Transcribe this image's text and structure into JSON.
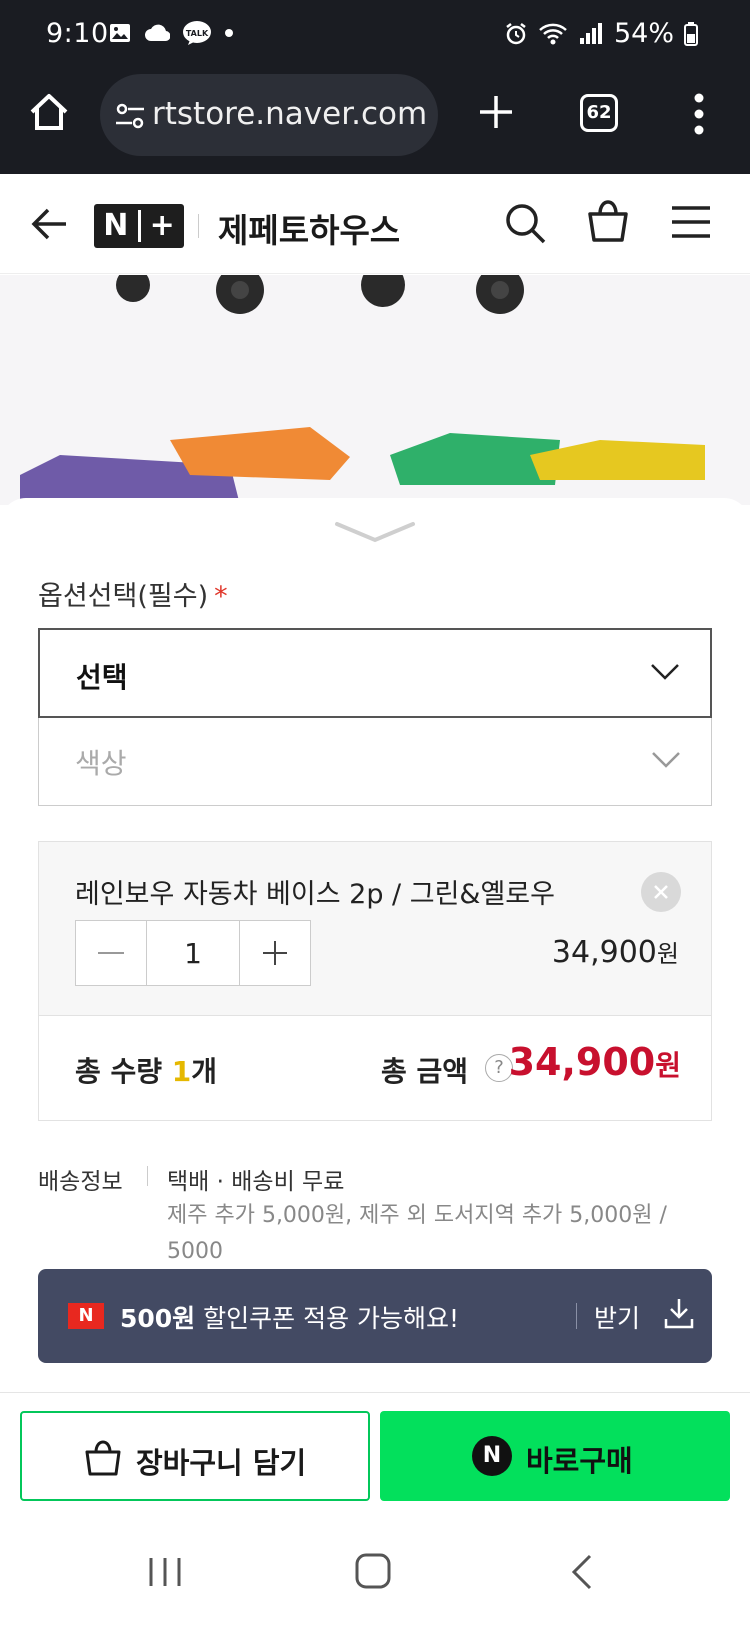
{
  "status": {
    "time": "9:10",
    "battery": "54%"
  },
  "browser": {
    "url": "rtstore.naver.com",
    "tab_count": "62"
  },
  "header": {
    "brand_left": "N",
    "brand_right": "+",
    "store_name": "제페토하우스"
  },
  "options": {
    "label": "옵션선택(필수)",
    "required_mark": "*",
    "select_value": "선택",
    "color_placeholder": "색상"
  },
  "item": {
    "name": "레인보우 자동차 베이스 2p / 그린&옐로우",
    "quantity": "1",
    "price": "34,900",
    "currency": "원"
  },
  "totals": {
    "qty_prefix": "총 수량 ",
    "qty_value": "1",
    "qty_suffix": "개",
    "amount_label": "총 금액",
    "help": "?",
    "amount": "34,900",
    "currency": "원"
  },
  "shipping": {
    "label": "배송정보",
    "main": "택배 · 배송비 무료",
    "sub": "제주 추가 5,000원, 제주 외 도서지역 추가 5,000원 / 5000"
  },
  "coupon": {
    "badge": "N",
    "amount": "500원",
    "text": " 할인쿠폰 적용 가능해요!",
    "action": "받기"
  },
  "actions": {
    "cart": "장바구니 담기",
    "buy_badge": "N",
    "buy": "바로구매"
  },
  "colors": {
    "naver_green": "#03C75A",
    "price_red": "#C8102E",
    "coupon_bg": "#434A63"
  }
}
